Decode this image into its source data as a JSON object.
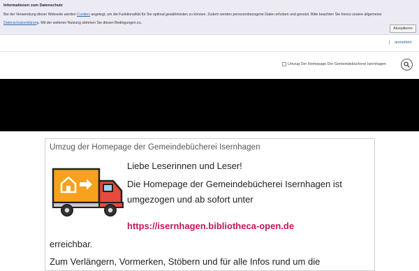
{
  "cookie_banner": {
    "title": "Informationen zum Datenschutz",
    "text_part1": "Bei der Verwendung dieser Webseite werden ",
    "cookies_link": "Cookies",
    "text_part2": " angelegt, um die Funktionalität für Sie optimal gewährleisten zu können. Zudem werden personenbezogene Daten erhoben und genutzt. Bitte beachten Sie hierzu unsere allgemeine ",
    "privacy_link": "Datenschutzerklärung",
    "text_part3": ". Mit der weiteren Nutzung stimmen Sie diesen Bedingungen zu.",
    "accept_label": "Akzeptieren"
  },
  "topbar": {
    "separator": "|",
    "login_label": "anmelden"
  },
  "header": {
    "logo_alt": "Umzug Der Homepage Der Gemeindebücherei Isernhagen"
  },
  "article": {
    "title": "Umzug der Homepage der Gemeindebücherei Isernhagen",
    "greeting": "Liebe Leserinnen und Leser!",
    "line1": "Die Homepage der Gemeindebücherei Isernhagen ist",
    "line2": "umgezogen und ab sofort unter",
    "link": "https://isernhagen.bibliotheca-open.de",
    "line3": "erreichbar.",
    "line4": "Zum Verlängern, Vormerken, Stöbern und für alle Infos rund um die"
  },
  "colors": {
    "banner_bg": "#ecebf4",
    "link_blue": "#2a6ab3",
    "accent_link": "#c4165a",
    "hero_bg": "#000000",
    "truck_box": "#f6a21e",
    "truck_cab": "#e64b3c"
  }
}
